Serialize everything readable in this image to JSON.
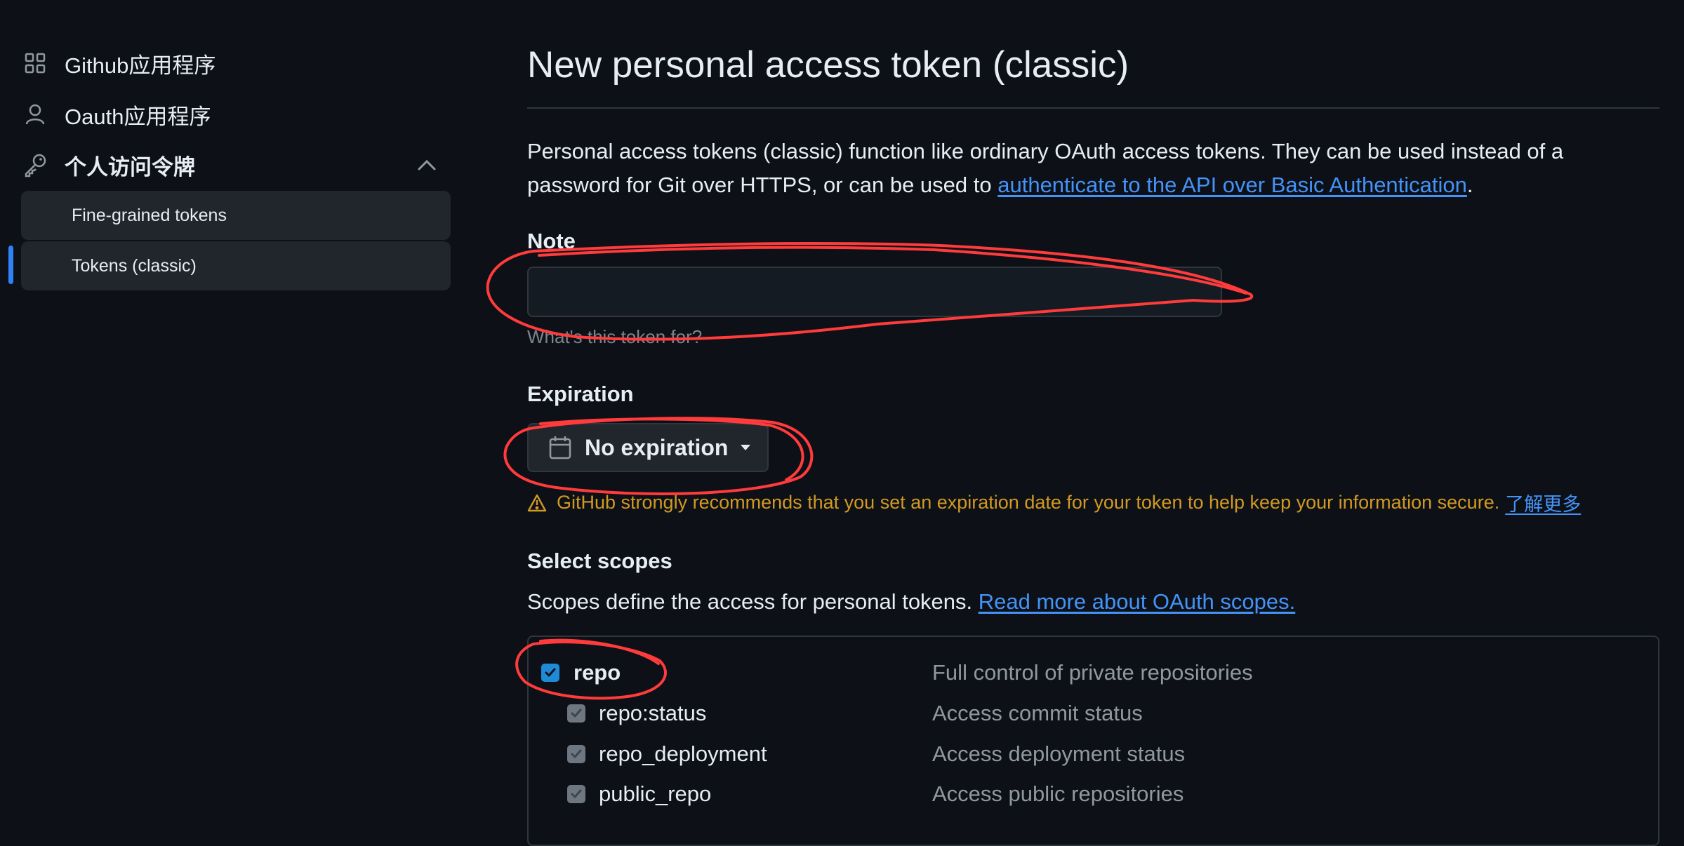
{
  "sidebar": {
    "items": [
      {
        "label": "Github应用程序",
        "icon": "apps-grid-icon"
      },
      {
        "label": "Oauth应用程序",
        "icon": "person-icon"
      },
      {
        "label": "个人访问令牌",
        "icon": "key-icon"
      }
    ],
    "sub_items": [
      {
        "label": "Fine-grained tokens"
      },
      {
        "label": "Tokens (classic)",
        "active": true
      }
    ]
  },
  "main": {
    "title": "New personal access token (classic)",
    "intro_text": "Personal access tokens (classic) function like ordinary OAuth access tokens. They can be used instead of a password for Git over HTTPS, or can be used to ",
    "intro_link": "authenticate to the API over Basic Authentication",
    "intro_end": ".",
    "note": {
      "label": "Note",
      "value": "",
      "hint": "What's this token for?"
    },
    "expiration": {
      "label": "Expiration",
      "selected": "No expiration",
      "warning": "GitHub strongly recommends that you set an expiration date for your token to help keep your information secure.",
      "warning_link": "了解更多"
    },
    "scopes": {
      "label": "Select scopes",
      "description": "Scopes define the access for personal tokens. ",
      "link": "Read more about OAuth scopes.",
      "rows": [
        {
          "name": "repo",
          "desc": "Full control of private repositories",
          "checked": true,
          "primary": true
        },
        {
          "name": "repo:status",
          "desc": "Access commit status",
          "checked": true,
          "primary": false
        },
        {
          "name": "repo_deployment",
          "desc": "Access deployment status",
          "checked": true,
          "primary": false
        },
        {
          "name": "public_repo",
          "desc": "Access public repositories",
          "checked": true,
          "primary": false
        }
      ]
    }
  },
  "colors": {
    "background": "#0d1117",
    "accent": "#2f81f7",
    "link": "#4493f8",
    "warning": "#d29922",
    "annotation": "#ff3b3b"
  }
}
